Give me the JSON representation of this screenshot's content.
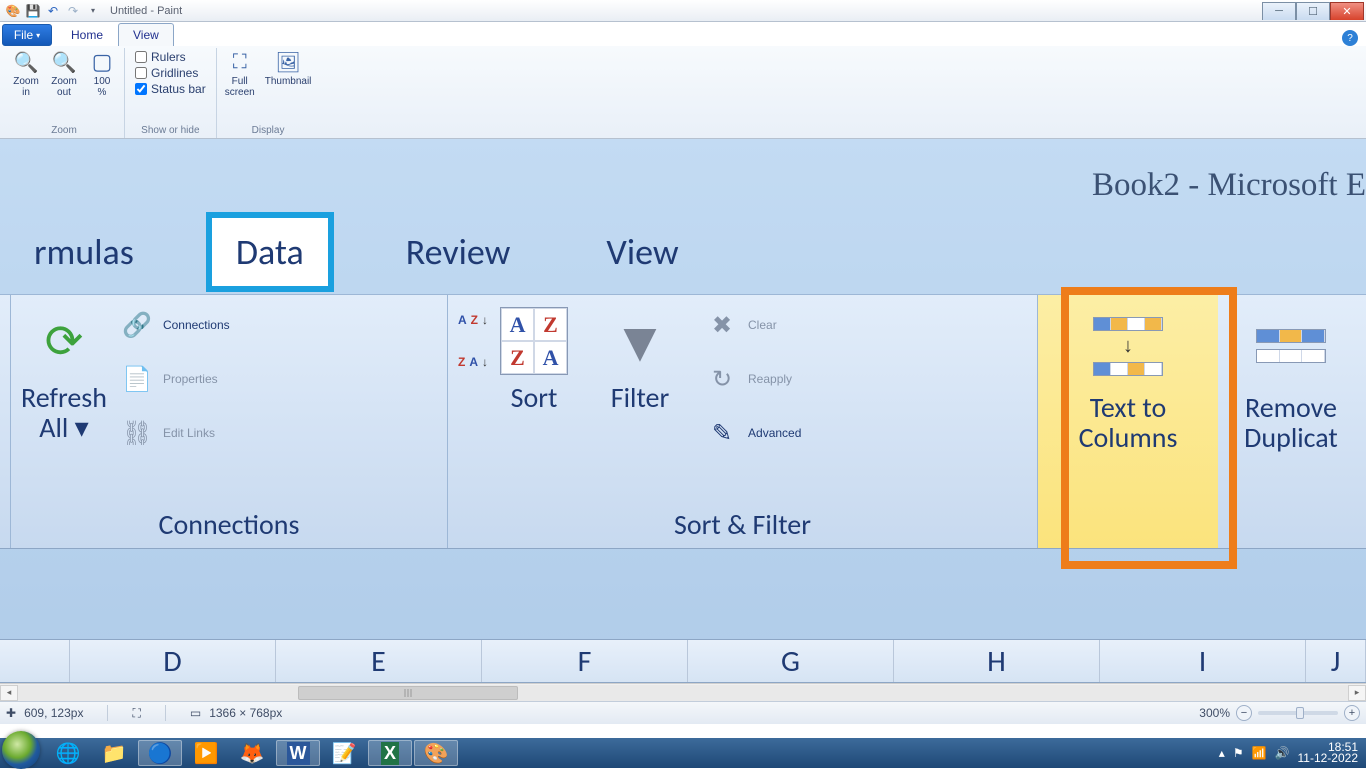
{
  "titlebar": {
    "title": "Untitled - Paint"
  },
  "winbtns": {
    "min": "─",
    "max": "☐",
    "close": "✕"
  },
  "file_label": "File",
  "paint_tabs": {
    "home": "Home",
    "view": "View"
  },
  "zoom_group": {
    "label": "Zoom",
    "in": "Zoom\nin",
    "out": "Zoom\nout",
    "pct": "100\n%"
  },
  "show_group": {
    "label": "Show or hide",
    "rulers": "Rulers",
    "gridlines": "Gridlines",
    "statusbar": "Status bar"
  },
  "display_group": {
    "label": "Display",
    "full": "Full\nscreen",
    "thumb": "Thumbnail"
  },
  "excel": {
    "title": "Book2 - Microsoft E",
    "tabs": {
      "formulas": "rmulas",
      "data": "Data",
      "review": "Review",
      "view": "View"
    },
    "refresh": "Refresh\nAll ▾",
    "conn_group": "Connections",
    "conn_items": {
      "connections": "Connections",
      "properties": "Properties",
      "editlinks": "Edit Links"
    },
    "sort": "Sort",
    "filter": "Filter",
    "sf_group": "Sort & Filter",
    "filter_items": {
      "clear": "Clear",
      "reapply": "Reapply",
      "advanced": "Advanced"
    },
    "ttc": "Text to\nColumns",
    "rmdup": "Remove\nDuplicat",
    "cols": [
      "D",
      "E",
      "F",
      "G",
      "H",
      "I",
      "J"
    ]
  },
  "status": {
    "pos": "609, 123px",
    "canvas": "1366 × 768px",
    "zoom": "300%"
  },
  "tray": {
    "time": "18:51",
    "date": "11-12-2022"
  }
}
